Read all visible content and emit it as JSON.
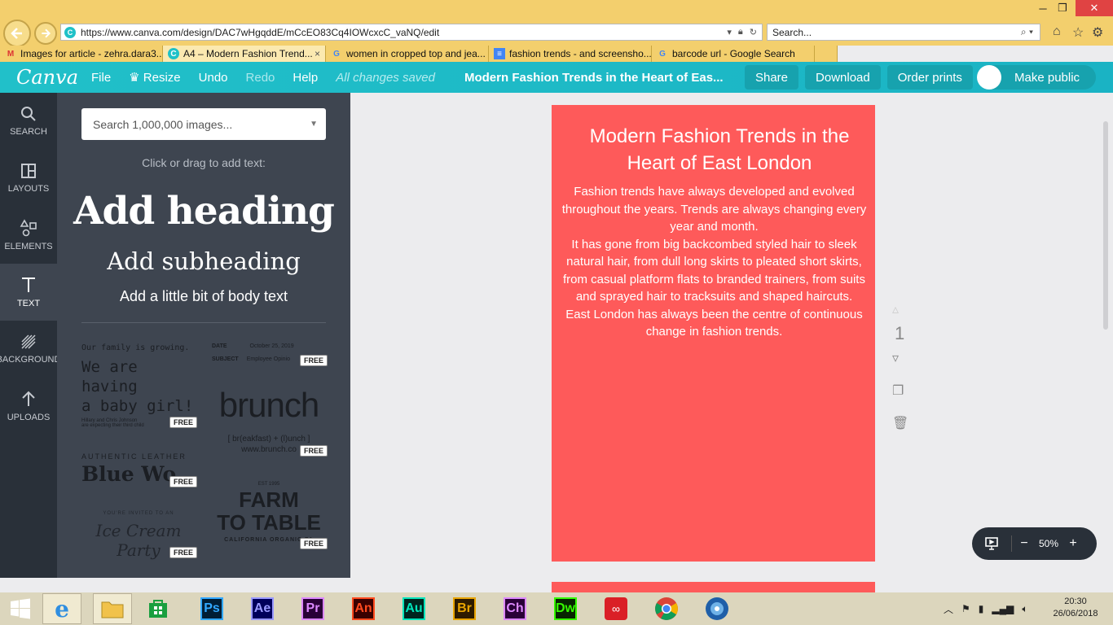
{
  "browser": {
    "url": "https://www.canva.com/design/DAC7wHgqddE/mCcEO83Cq4IOWcxcC_vaNQ/edit",
    "search_placeholder": "Search...",
    "tabs": [
      {
        "label": "Images for article - zehra.dara3...",
        "icon": "gmail-icon",
        "active": false
      },
      {
        "label": "A4 – Modern Fashion Trend...",
        "icon": "canva-icon",
        "active": true
      },
      {
        "label": "women in cropped top and jea...",
        "icon": "google-icon",
        "active": false
      },
      {
        "label": "fashion trends - and screensho...",
        "icon": "docs-icon",
        "active": false
      },
      {
        "label": "barcode url - Google Search",
        "icon": "google-icon",
        "active": false
      }
    ],
    "close_tab_glyph": "×"
  },
  "header": {
    "logo": "Canva",
    "menu": {
      "file": "File",
      "resize": "Resize",
      "undo": "Undo",
      "redo": "Redo",
      "help": "Help"
    },
    "saved_status": "All changes saved",
    "doc_title": "Modern Fashion Trends in the Heart of Eas...",
    "share": "Share",
    "download": "Download",
    "order_prints": "Order prints",
    "make_public": "Make public"
  },
  "rail": {
    "search": "SEARCH",
    "layouts": "LAYOUTS",
    "elements": "ELEMENTS",
    "text": "TEXT",
    "background": "BACKGROUND",
    "uploads": "UPLOADS"
  },
  "panel": {
    "search_placeholder": "Search 1,000,000 images...",
    "hint": "Click or drag to add text:",
    "add_heading": "Add heading",
    "add_subheading": "Add subheading",
    "add_body": "Add a little bit of body text",
    "free_label": "FREE",
    "templates": {
      "baby_line1": "Our family is growing.",
      "baby_line2": "We are having",
      "baby_line3": "a baby girl!",
      "baby_line4": "Hillary and Chris Johnson",
      "baby_line5": "are expecting their third child",
      "memo_date_label": "DATE",
      "memo_date_value": "October 25, 2019",
      "memo_subject_label": "SUBJECT",
      "memo_subject_value": "Employee Opinio",
      "brunch_title": "brunch",
      "brunch_line1": "[ br(eakfast) + (l)unch ]",
      "brunch_line2": "www.brunch.co",
      "leather_line1": "AUTHENTIC LEATHER",
      "leather_line2": "Blue Wo",
      "farm_small": "EST 1995",
      "farm_line1": "FARM",
      "farm_line2": "TO TABLE",
      "farm_line3": "CALIFORNIA ORGANIC FA",
      "party_line1": "YOU'RE INVITED TO AN",
      "party_line2": "Ice Cream Party"
    }
  },
  "canvas": {
    "page_title": "Modern Fashion Trends in the Heart of East London",
    "page_body_1": "Fashion trends have always developed and evolved throughout the years. Trends are always changing every year and month.",
    "page_body_2": "It has gone from big backcombed styled hair to sleek natural hair, from dull long skirts to pleated short skirts, from casual platform flats to branded trainers, from suits and sprayed hair to tracksuits and shaped haircuts.",
    "page_body_3": "East London has always been the centre of continuous change in fashion trends.",
    "page_number": "1",
    "page_color": "#fe5a5a",
    "zoom": "50%"
  },
  "taskbar": {
    "apps": [
      {
        "label": "Ps",
        "color": "#31a8ff",
        "bg": "#001e36"
      },
      {
        "label": "Ae",
        "color": "#9999ff",
        "bg": "#00005b"
      },
      {
        "label": "Pr",
        "color": "#9999ff",
        "bg": "#00005b"
      },
      {
        "label": "An",
        "color": "#ff4a1f",
        "bg": "#3a0000"
      },
      {
        "label": "Au",
        "color": "#00e4bb",
        "bg": "#00241f"
      },
      {
        "label": "Br",
        "color": "#e8a400",
        "bg": "#2d1b00"
      },
      {
        "label": "Ch",
        "color": "#dd88ff",
        "bg": "#2a0037"
      },
      {
        "label": "Dw",
        "color": "#35fa00",
        "bg": "#072401"
      }
    ],
    "time": "20:30",
    "date": "26/06/2018"
  }
}
